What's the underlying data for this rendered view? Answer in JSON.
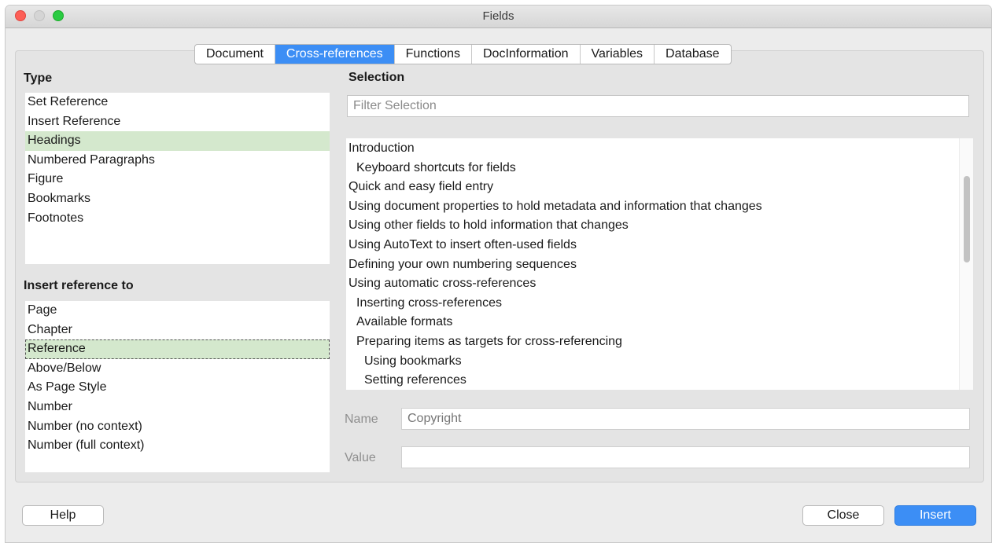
{
  "window": {
    "title": "Fields"
  },
  "tabs": [
    "Document",
    "Cross-references",
    "Functions",
    "DocInformation",
    "Variables",
    "Database"
  ],
  "active_tab": "Cross-references",
  "type_section": {
    "heading": "Type",
    "items": [
      "Set Reference",
      "Insert Reference",
      "Headings",
      "Numbered Paragraphs",
      "Figure",
      "Bookmarks",
      "Footnotes"
    ],
    "selected": "Headings"
  },
  "insert_ref_section": {
    "heading": "Insert reference to",
    "items": [
      "Page",
      "Chapter",
      "Reference",
      "Above/Below",
      "As Page Style",
      "Number",
      "Number (no context)",
      "Number (full context)"
    ],
    "selected": "Reference"
  },
  "selection_section": {
    "heading": "Selection",
    "filter_placeholder": "Filter Selection",
    "items": [
      {
        "text": "Introduction",
        "level": 0
      },
      {
        "text": "Keyboard shortcuts for fields",
        "level": 1
      },
      {
        "text": "Quick and easy field entry",
        "level": 0
      },
      {
        "text": "Using document properties to hold metadata and information that changes",
        "level": 0
      },
      {
        "text": "Using other fields to hold information that changes",
        "level": 0
      },
      {
        "text": "Using AutoText to insert often-used fields",
        "level": 0
      },
      {
        "text": "Defining your own numbering sequences",
        "level": 0
      },
      {
        "text": "Using automatic cross-references",
        "level": 0
      },
      {
        "text": "Inserting cross-references",
        "level": 1
      },
      {
        "text": "Available formats",
        "level": 1
      },
      {
        "text": "Preparing items as targets for cross-referencing",
        "level": 1
      },
      {
        "text": "Using bookmarks",
        "level": 2
      },
      {
        "text": "Setting references",
        "level": 2
      }
    ]
  },
  "name_field": {
    "label": "Name",
    "placeholder": "Copyright"
  },
  "value_field": {
    "label": "Value",
    "value": ""
  },
  "buttons": {
    "help": "Help",
    "close": "Close",
    "insert": "Insert"
  },
  "colors": {
    "accent": "#3c8ef5",
    "selected_row": "#d4e8cd",
    "close_light": "#fd5f57",
    "maximize_light": "#2acb42"
  }
}
